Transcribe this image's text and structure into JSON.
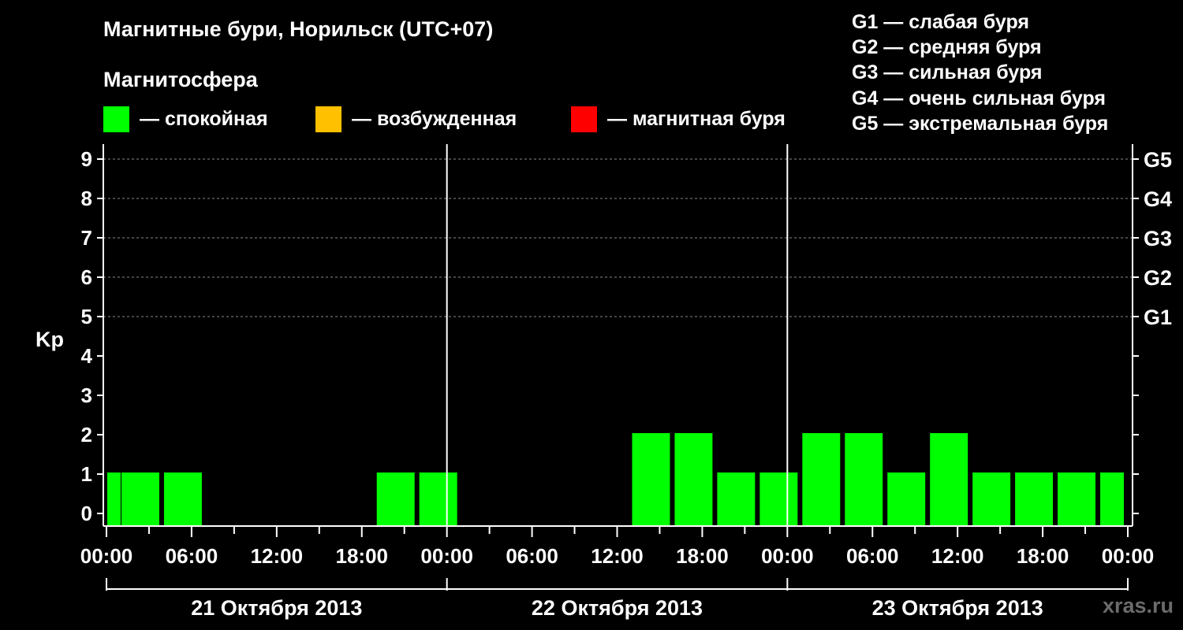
{
  "title": "Магнитные бури, Норильск (UTC+07)",
  "subtitle": "Магнитосфера",
  "legend": [
    {
      "label": "— спокойная",
      "color": "#00ff00"
    },
    {
      "label": "— возбужденная",
      "color": "#ffc000"
    },
    {
      "label": "— магнитная буря",
      "color": "#ff0000"
    }
  ],
  "g_legend": [
    "G1 — слабая буря",
    "G2 — средняя буря",
    "G3 — сильная буря",
    "G4 — очень сильная буря",
    "G5 — экстремальная буря"
  ],
  "watermark": "xras.ru",
  "chart_data": {
    "type": "bar",
    "ylabel": "Kp",
    "ylim": [
      0,
      9
    ],
    "y_ticks": [
      "0",
      "1",
      "2",
      "3",
      "4",
      "5",
      "6",
      "7",
      "8",
      "9"
    ],
    "g_ticks": [
      {
        "kp": 5,
        "label": "G1"
      },
      {
        "kp": 6,
        "label": "G2"
      },
      {
        "kp": 7,
        "label": "G3"
      },
      {
        "kp": 8,
        "label": "G4"
      },
      {
        "kp": 9,
        "label": "G5"
      }
    ],
    "x_tick_labels": [
      "00:00",
      "06:00",
      "12:00",
      "18:00",
      "00:00",
      "06:00",
      "12:00",
      "18:00",
      "00:00",
      "06:00",
      "12:00",
      "18:00",
      "00:00"
    ],
    "days": [
      "21 Октября 2013",
      "22 Октября 2013",
      "23 Октября 2013"
    ],
    "grid": true,
    "bar_color": "#00ff00",
    "bars": [
      {
        "start_hour": 0,
        "end_hour": 1,
        "kp": 1
      },
      {
        "start_hour": 1,
        "end_hour": 4,
        "kp": 1
      },
      {
        "start_hour": 4,
        "end_hour": 7,
        "kp": 1
      },
      {
        "start_hour": 7,
        "end_hour": 10,
        "kp": 0
      },
      {
        "start_hour": 10,
        "end_hour": 13,
        "kp": 0
      },
      {
        "start_hour": 13,
        "end_hour": 16,
        "kp": 0
      },
      {
        "start_hour": 16,
        "end_hour": 19,
        "kp": 0
      },
      {
        "start_hour": 19,
        "end_hour": 22,
        "kp": 1
      },
      {
        "start_hour": 22,
        "end_hour": 25,
        "kp": 1
      },
      {
        "start_hour": 25,
        "end_hour": 28,
        "kp": 0
      },
      {
        "start_hour": 28,
        "end_hour": 31,
        "kp": 0
      },
      {
        "start_hour": 31,
        "end_hour": 34,
        "kp": 0
      },
      {
        "start_hour": 34,
        "end_hour": 37,
        "kp": 0
      },
      {
        "start_hour": 37,
        "end_hour": 40,
        "kp": 2
      },
      {
        "start_hour": 40,
        "end_hour": 43,
        "kp": 2
      },
      {
        "start_hour": 43,
        "end_hour": 46,
        "kp": 1
      },
      {
        "start_hour": 46,
        "end_hour": 49,
        "kp": 1
      },
      {
        "start_hour": 49,
        "end_hour": 52,
        "kp": 2
      },
      {
        "start_hour": 52,
        "end_hour": 55,
        "kp": 2
      },
      {
        "start_hour": 55,
        "end_hour": 58,
        "kp": 1
      },
      {
        "start_hour": 58,
        "end_hour": 61,
        "kp": 2
      },
      {
        "start_hour": 61,
        "end_hour": 64,
        "kp": 1
      },
      {
        "start_hour": 64,
        "end_hour": 67,
        "kp": 1
      },
      {
        "start_hour": 67,
        "end_hour": 70,
        "kp": 1
      },
      {
        "start_hour": 70,
        "end_hour": 72,
        "kp": 1
      }
    ]
  }
}
